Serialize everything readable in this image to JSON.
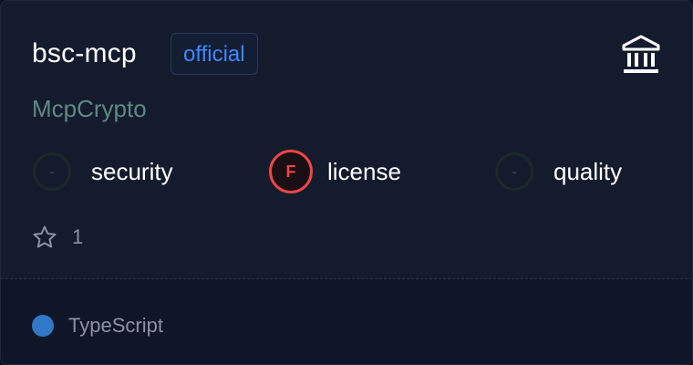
{
  "card": {
    "title": "bsc-mcp",
    "badge": "official",
    "owner": "McpCrypto",
    "org_icon": "institution-icon",
    "scores": [
      {
        "label": "security",
        "grade": "-",
        "status": "none"
      },
      {
        "label": "license",
        "grade": "F",
        "status": "fail"
      },
      {
        "label": "quality",
        "grade": "-",
        "status": "none"
      }
    ],
    "stars": {
      "icon": "star-icon",
      "count": "1"
    },
    "language": {
      "name": "TypeScript",
      "color": "#3178c6"
    }
  },
  "colors": {
    "accent": "#3f86ff",
    "fail": "#ef4444",
    "owner": "#5e8a82"
  }
}
